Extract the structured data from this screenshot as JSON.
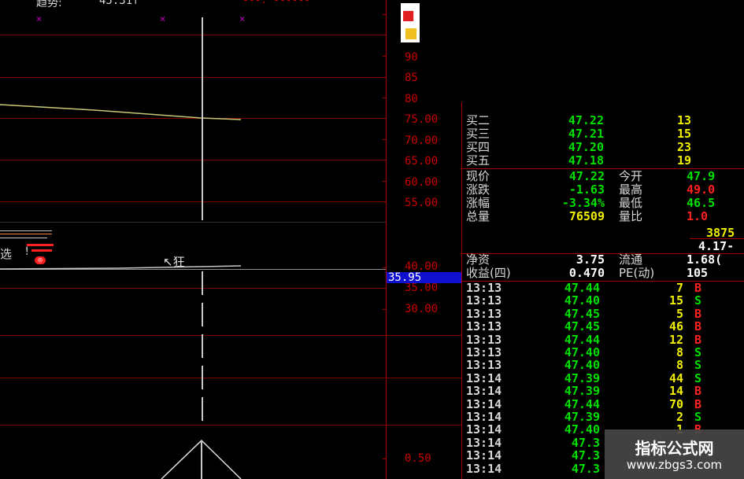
{
  "colors": {
    "background": "#000000",
    "grid": "#7a0000",
    "axis_text": "#c80000",
    "price_up": "#ff2020",
    "price_down": "#00e000",
    "volume": "#f0f000",
    "label": "#d8d8d8",
    "highlight": "#1010d0"
  },
  "top_bar": {
    "label": "趋势:",
    "value": "45.31↑",
    "right_text": "---:  ------"
  },
  "price_axis_upper": [
    "90",
    "85",
    "80",
    "75.00",
    "70.00",
    "65.00",
    "60.00",
    "55.00"
  ],
  "price_axis_lower": [
    "40.00",
    "35.00",
    "30.00"
  ],
  "current_price_tag": "35.95",
  "indicator_axis": [
    "0.50"
  ],
  "chart_annotation": "↖狂",
  "sell_label_fragment": "选",
  "bid_queue": [
    {
      "name": "买二",
      "price": "47.22",
      "volume": "13"
    },
    {
      "name": "买三",
      "price": "47.21",
      "volume": "15"
    },
    {
      "name": "买四",
      "price": "47.20",
      "volume": "23"
    },
    {
      "name": "买五",
      "price": "47.18",
      "volume": "19"
    }
  ],
  "stats": [
    {
      "label": "现价",
      "value": "47.22",
      "label2": "今开",
      "value2": "47.9"
    },
    {
      "label": "涨跌",
      "value": "-1.63",
      "label2": "最高",
      "value2": "49.0"
    },
    {
      "label": "涨幅",
      "value": "-3.34%",
      "label2": "最低",
      "value2": "46.5"
    },
    {
      "label": "总量",
      "value": "76509",
      "label2": "量比",
      "value2": "1.0"
    }
  ],
  "stats_extra": [
    "3875",
    "4.17-"
  ],
  "fundamentals": [
    {
      "label": "净资",
      "value": "3.75",
      "label2": "流通",
      "value2": "1.68("
    },
    {
      "label": "收益(四)",
      "value": "0.470",
      "label2": "PE(动)",
      "value2": "105"
    }
  ],
  "ticks": [
    {
      "time": "13:13",
      "price": "47.44",
      "volume": "7",
      "flag": "B"
    },
    {
      "time": "13:13",
      "price": "47.40",
      "volume": "15",
      "flag": "S"
    },
    {
      "time": "13:13",
      "price": "47.45",
      "volume": "5",
      "flag": "B"
    },
    {
      "time": "13:13",
      "price": "47.45",
      "volume": "46",
      "flag": "B"
    },
    {
      "time": "13:13",
      "price": "47.44",
      "volume": "12",
      "flag": "B"
    },
    {
      "time": "13:13",
      "price": "47.40",
      "volume": "8",
      "flag": "S"
    },
    {
      "time": "13:13",
      "price": "47.40",
      "volume": "8",
      "flag": "S"
    },
    {
      "time": "13:14",
      "price": "47.39",
      "volume": "44",
      "flag": "S"
    },
    {
      "time": "13:14",
      "price": "47.39",
      "volume": "14",
      "flag": "B"
    },
    {
      "time": "13:14",
      "price": "47.44",
      "volume": "70",
      "flag": "B"
    },
    {
      "time": "13:14",
      "price": "47.39",
      "volume": "2",
      "flag": "S"
    },
    {
      "time": "13:14",
      "price": "47.40",
      "volume": "1",
      "flag": "B"
    },
    {
      "time": "13:14",
      "price": "47.3",
      "volume": "",
      "flag": ""
    },
    {
      "time": "13:14",
      "price": "47.3",
      "volume": "",
      "flag": ""
    },
    {
      "time": "13:14",
      "price": "47.3",
      "volume": "",
      "flag": ""
    }
  ],
  "watermark": {
    "title": "指标公式网",
    "url": "www.zbgs3.com"
  }
}
